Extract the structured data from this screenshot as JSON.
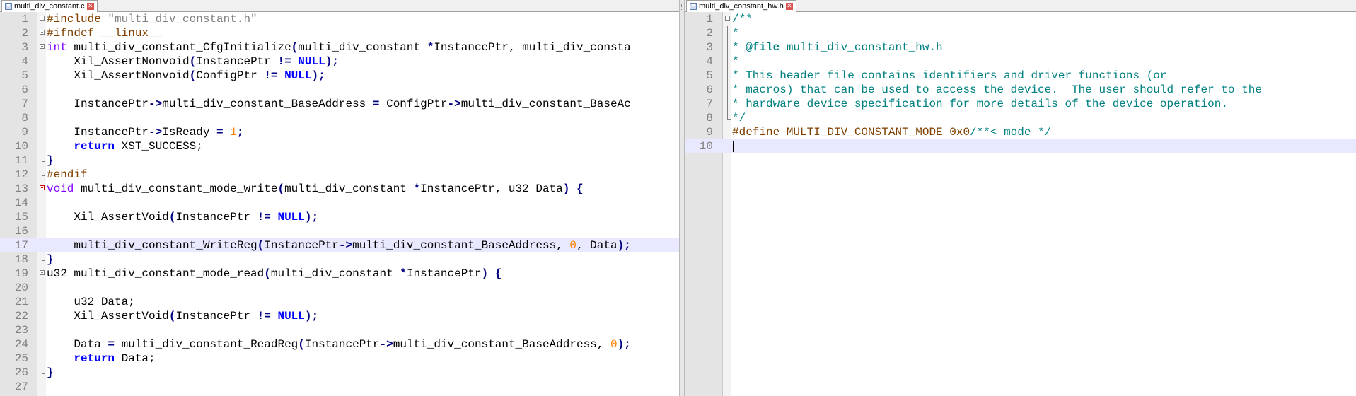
{
  "left_pane": {
    "tab_label": "multi_div_constant.c",
    "current_line": 17,
    "lines": [
      {
        "n": "1",
        "fold": "box",
        "tokens": [
          [
            "pp",
            "#include "
          ],
          [
            "str",
            "\"multi_div_constant.h\""
          ]
        ]
      },
      {
        "n": "2",
        "fold": "box",
        "tokens": [
          [
            "pp",
            "#ifndef __linux__"
          ]
        ]
      },
      {
        "n": "3",
        "fold": "box",
        "tokens": [
          [
            "typ",
            "int"
          ],
          [
            "id",
            " multi_div_constant_CfgInitialize"
          ],
          [
            "op",
            "("
          ],
          [
            "id",
            "multi_div_constant "
          ],
          [
            "op",
            "*"
          ],
          [
            "id",
            "InstancePtr, multi_div_consta"
          ]
        ]
      },
      {
        "n": "4",
        "fold": "vline",
        "tokens": [
          [
            "id",
            "    Xil_AssertNonvoid"
          ],
          [
            "op",
            "("
          ],
          [
            "id",
            "InstancePtr "
          ],
          [
            "op",
            "!="
          ],
          [
            "id",
            " "
          ],
          [
            "kw",
            "NULL"
          ],
          [
            "op",
            ");"
          ]
        ]
      },
      {
        "n": "5",
        "fold": "vline",
        "tokens": [
          [
            "id",
            "    Xil_AssertNonvoid"
          ],
          [
            "op",
            "("
          ],
          [
            "id",
            "ConfigPtr "
          ],
          [
            "op",
            "!="
          ],
          [
            "id",
            " "
          ],
          [
            "kw",
            "NULL"
          ],
          [
            "op",
            ");"
          ]
        ]
      },
      {
        "n": "6",
        "fold": "vline",
        "tokens": []
      },
      {
        "n": "7",
        "fold": "vline",
        "tokens": [
          [
            "id",
            "    InstancePtr"
          ],
          [
            "op",
            "->"
          ],
          [
            "id",
            "multi_div_constant_BaseAddress "
          ],
          [
            "op",
            "="
          ],
          [
            "id",
            " ConfigPtr"
          ],
          [
            "op",
            "->"
          ],
          [
            "id",
            "multi_div_constant_BaseAc"
          ]
        ]
      },
      {
        "n": "8",
        "fold": "vline",
        "tokens": []
      },
      {
        "n": "9",
        "fold": "vline",
        "tokens": [
          [
            "id",
            "    InstancePtr"
          ],
          [
            "op",
            "->"
          ],
          [
            "id",
            "IsReady "
          ],
          [
            "op",
            "="
          ],
          [
            "id",
            " "
          ],
          [
            "num",
            "1"
          ],
          [
            "op",
            ";"
          ]
        ]
      },
      {
        "n": "10",
        "fold": "vline",
        "tokens": [
          [
            "id",
            "    "
          ],
          [
            "kw",
            "return"
          ],
          [
            "id",
            " XST_SUCCESS;"
          ]
        ]
      },
      {
        "n": "11",
        "fold": "end",
        "tokens": [
          [
            "op",
            "}"
          ]
        ]
      },
      {
        "n": "12",
        "fold": "end",
        "tokens": [
          [
            "pp",
            "#endif"
          ]
        ]
      },
      {
        "n": "13",
        "fold": "boxred",
        "tokens": [
          [
            "typ",
            "void"
          ],
          [
            "id",
            " multi_div_constant_mode_write"
          ],
          [
            "op",
            "("
          ],
          [
            "id",
            "multi_div_constant "
          ],
          [
            "op",
            "*"
          ],
          [
            "id",
            "InstancePtr, u32 Data"
          ],
          [
            "op",
            ")"
          ],
          [
            "id",
            " "
          ],
          [
            "op",
            "{"
          ]
        ]
      },
      {
        "n": "14",
        "fold": "vline",
        "tokens": []
      },
      {
        "n": "15",
        "fold": "vline",
        "tokens": [
          [
            "id",
            "    Xil_AssertVoid"
          ],
          [
            "op",
            "("
          ],
          [
            "id",
            "InstancePtr "
          ],
          [
            "op",
            "!="
          ],
          [
            "id",
            " "
          ],
          [
            "kw",
            "NULL"
          ],
          [
            "op",
            ");"
          ]
        ]
      },
      {
        "n": "16",
        "fold": "vline",
        "tokens": []
      },
      {
        "n": "17",
        "fold": "vline",
        "tokens": [
          [
            "id",
            "    multi_div_constant_WriteReg"
          ],
          [
            "op",
            "("
          ],
          [
            "id",
            "InstancePtr"
          ],
          [
            "op",
            "->"
          ],
          [
            "id",
            "multi_div_constant_BaseAddress, "
          ],
          [
            "num",
            "0"
          ],
          [
            "id",
            ", Data"
          ],
          [
            "op",
            ");"
          ]
        ]
      },
      {
        "n": "18",
        "fold": "end",
        "tokens": [
          [
            "op",
            "}"
          ]
        ]
      },
      {
        "n": "19",
        "fold": "box",
        "tokens": [
          [
            "id",
            "u32 multi_div_constant_mode_read"
          ],
          [
            "op",
            "("
          ],
          [
            "id",
            "multi_div_constant "
          ],
          [
            "op",
            "*"
          ],
          [
            "id",
            "InstancePtr"
          ],
          [
            "op",
            ")"
          ],
          [
            "id",
            " "
          ],
          [
            "op",
            "{"
          ]
        ]
      },
      {
        "n": "20",
        "fold": "vline",
        "tokens": []
      },
      {
        "n": "21",
        "fold": "vline",
        "tokens": [
          [
            "id",
            "    u32 Data;"
          ]
        ]
      },
      {
        "n": "22",
        "fold": "vline",
        "tokens": [
          [
            "id",
            "    Xil_AssertVoid"
          ],
          [
            "op",
            "("
          ],
          [
            "id",
            "InstancePtr "
          ],
          [
            "op",
            "!="
          ],
          [
            "id",
            " "
          ],
          [
            "kw",
            "NULL"
          ],
          [
            "op",
            ");"
          ]
        ]
      },
      {
        "n": "23",
        "fold": "vline",
        "tokens": []
      },
      {
        "n": "24",
        "fold": "vline",
        "tokens": [
          [
            "id",
            "    Data "
          ],
          [
            "op",
            "="
          ],
          [
            "id",
            " multi_div_constant_ReadReg"
          ],
          [
            "op",
            "("
          ],
          [
            "id",
            "InstancePtr"
          ],
          [
            "op",
            "->"
          ],
          [
            "id",
            "multi_div_constant_BaseAddress, "
          ],
          [
            "num",
            "0"
          ],
          [
            "op",
            ");"
          ]
        ]
      },
      {
        "n": "25",
        "fold": "vline",
        "tokens": [
          [
            "id",
            "    "
          ],
          [
            "kw",
            "return"
          ],
          [
            "id",
            " Data;"
          ]
        ]
      },
      {
        "n": "26",
        "fold": "end",
        "tokens": [
          [
            "op",
            "}"
          ]
        ]
      },
      {
        "n": "27",
        "fold": "",
        "tokens": []
      }
    ]
  },
  "right_pane": {
    "tab_label": "multi_div_constant_hw.h",
    "current_line": 10,
    "lines": [
      {
        "n": "1",
        "fold": "box",
        "tokens": [
          [
            "cm",
            "/**"
          ]
        ]
      },
      {
        "n": "2",
        "fold": "vline",
        "tokens": [
          [
            "cm",
            "*"
          ]
        ]
      },
      {
        "n": "3",
        "fold": "vline",
        "tokens": [
          [
            "cm",
            "* "
          ],
          [
            "cmb",
            "@file"
          ],
          [
            "cm",
            " multi_div_constant_hw.h"
          ]
        ]
      },
      {
        "n": "4",
        "fold": "vline",
        "tokens": [
          [
            "cm",
            "*"
          ]
        ]
      },
      {
        "n": "5",
        "fold": "vline",
        "tokens": [
          [
            "cm",
            "* This header file contains identifiers and driver functions (or"
          ]
        ]
      },
      {
        "n": "6",
        "fold": "vline",
        "tokens": [
          [
            "cm",
            "* macros) that can be used to access the device.  The user should refer to the"
          ]
        ]
      },
      {
        "n": "7",
        "fold": "vline",
        "tokens": [
          [
            "cm",
            "* hardware device specification for more details of the device operation."
          ]
        ]
      },
      {
        "n": "8",
        "fold": "end",
        "tokens": [
          [
            "cm",
            "*/"
          ]
        ]
      },
      {
        "n": "9",
        "fold": "",
        "tokens": [
          [
            "pp",
            "#define MULTI_DIV_CONSTANT_MODE 0x0"
          ],
          [
            "cm",
            "/**< mode */"
          ]
        ]
      },
      {
        "n": "10",
        "fold": "",
        "tokens": []
      }
    ]
  },
  "colors": {
    "preprocessor": "#804000",
    "string": "#808080",
    "keyword": "#0000ff",
    "type": "#8000ff",
    "number": "#ff8000",
    "operator": "#000080",
    "comment": "#008080",
    "current_line_bg": "#e8e8ff",
    "gutter_bg": "#e4e4e4"
  },
  "icons": {
    "tab_file": "save-icon",
    "tab_close": "close-icon",
    "fold_marker": "fold-box-icon"
  }
}
